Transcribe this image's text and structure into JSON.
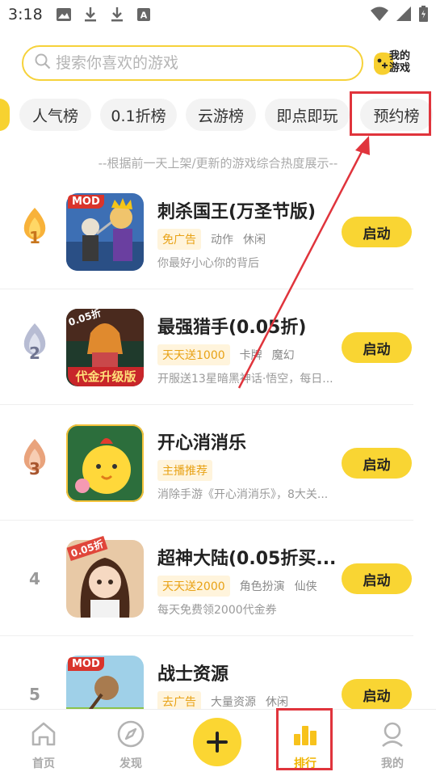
{
  "status_bar": {
    "time": "3:18"
  },
  "search": {
    "placeholder": "搜索你喜欢的游戏",
    "my_games_label": "我的游戏"
  },
  "tabs": [
    "人气榜",
    "0.1折榜",
    "云游榜",
    "即点即玩",
    "预约榜"
  ],
  "subtitle": "--根据前一天上架/更新的游戏综合热度展示--",
  "games": [
    {
      "rank": "1",
      "title": "刺杀国王(万圣节版)",
      "badge": "MOD",
      "hot_tag": "免广告",
      "tags": [
        "动作",
        "休闲"
      ],
      "desc": "你最好小心你的背后",
      "button": "启动"
    },
    {
      "rank": "2",
      "title": "最强猎手(0.05折)",
      "badge": "0.05折",
      "icon_caption": "代金升级版",
      "hot_tag": "天天送1000",
      "tags": [
        "卡牌",
        "魔幻"
      ],
      "desc": "开服送13星暗黑神话·悟空，每日...",
      "button": "启动"
    },
    {
      "rank": "3",
      "title": "开心消消乐",
      "hot_tag": "主播推荐",
      "tags": [],
      "desc": "消除手游《开心消消乐》，8大关...",
      "button": "启动"
    },
    {
      "rank": "4",
      "title": "超神大陆(0.05折买...",
      "badge": "0.05折",
      "hot_tag": "天天送2000",
      "tags": [
        "角色扮演",
        "仙侠"
      ],
      "desc": "每天免费领2000代金券",
      "button": "启动"
    },
    {
      "rank": "5",
      "title": "战士资源",
      "badge": "MOD",
      "hot_tag": "去广告",
      "tags": [
        "大量资源",
        "休闲"
      ],
      "desc": "",
      "button": "启动"
    }
  ],
  "bottom_nav": {
    "home": "首页",
    "discover": "发现",
    "rank": "排行",
    "mine": "我的"
  },
  "colors": {
    "accent": "#f9d533",
    "annotation": "#e0343c",
    "active_nav": "#f0b400"
  }
}
